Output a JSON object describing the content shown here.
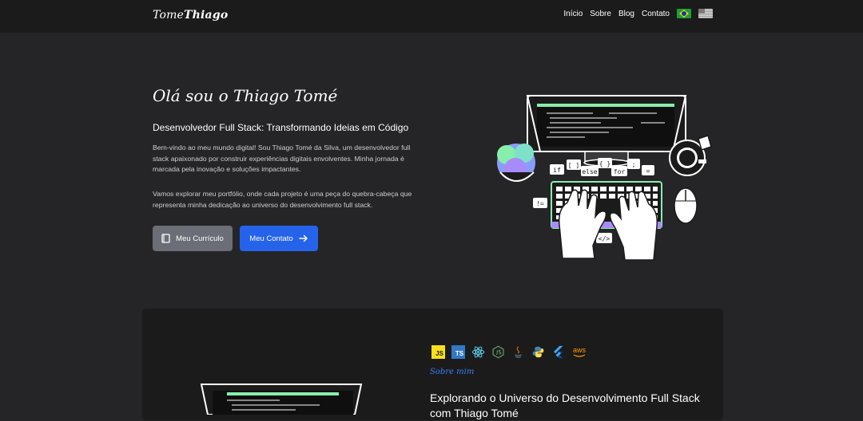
{
  "nav": {
    "logo_light": "Tome",
    "logo_bold": "Thiago",
    "links": [
      "Início",
      "Sobre",
      "Blog",
      "Contato"
    ],
    "flags": [
      "flag-brazil-icon",
      "flag-usa-icon"
    ]
  },
  "hero": {
    "title": "Olá sou o Thiago Tomé",
    "subtitle": "Desenvolvedor Full Stack: Transformando Ideias em Código",
    "paragraph1": "Bem-vindo ao meu mundo digital! Sou Thiago Tomé da Silva, um desenvolvedor full stack apaixonado por construir experiências digitais envolventes. Minha jornada é marcada pela inovação e soluções impactantes.",
    "paragraph2": "Vamos explorar meu portfólio, onde cada projeto é uma peça do quebra-cabeça que representa minha dedicação ao universo do desenvolvimento full stack.",
    "btn_cv": "Meu Currículo",
    "btn_contact": "Meu Contato",
    "code_bubbles": [
      "if",
      "[ ]",
      "else",
      "{ }",
      "for",
      ";",
      "=",
      "!=",
      "</>"
    ]
  },
  "about": {
    "tech_icons": [
      "javascript-icon",
      "typescript-icon",
      "react-icon",
      "nodejs-icon",
      "java-icon",
      "python-icon",
      "flutter-icon",
      "aws-icon"
    ],
    "js_label": "JS",
    "ts_label": "TS",
    "aws_label": "aws",
    "label": "Sobre mim",
    "title": "Explorando o Universo do Desenvolvimento Full Stack com Thiago Tomé"
  },
  "colors": {
    "background": "#252527",
    "navbar": "#1b1b1c",
    "primary_button": "#2563eb",
    "secondary_button": "#6b6e76",
    "accent_text": "#3b82f6",
    "keyboard_glow": "#86efac"
  }
}
